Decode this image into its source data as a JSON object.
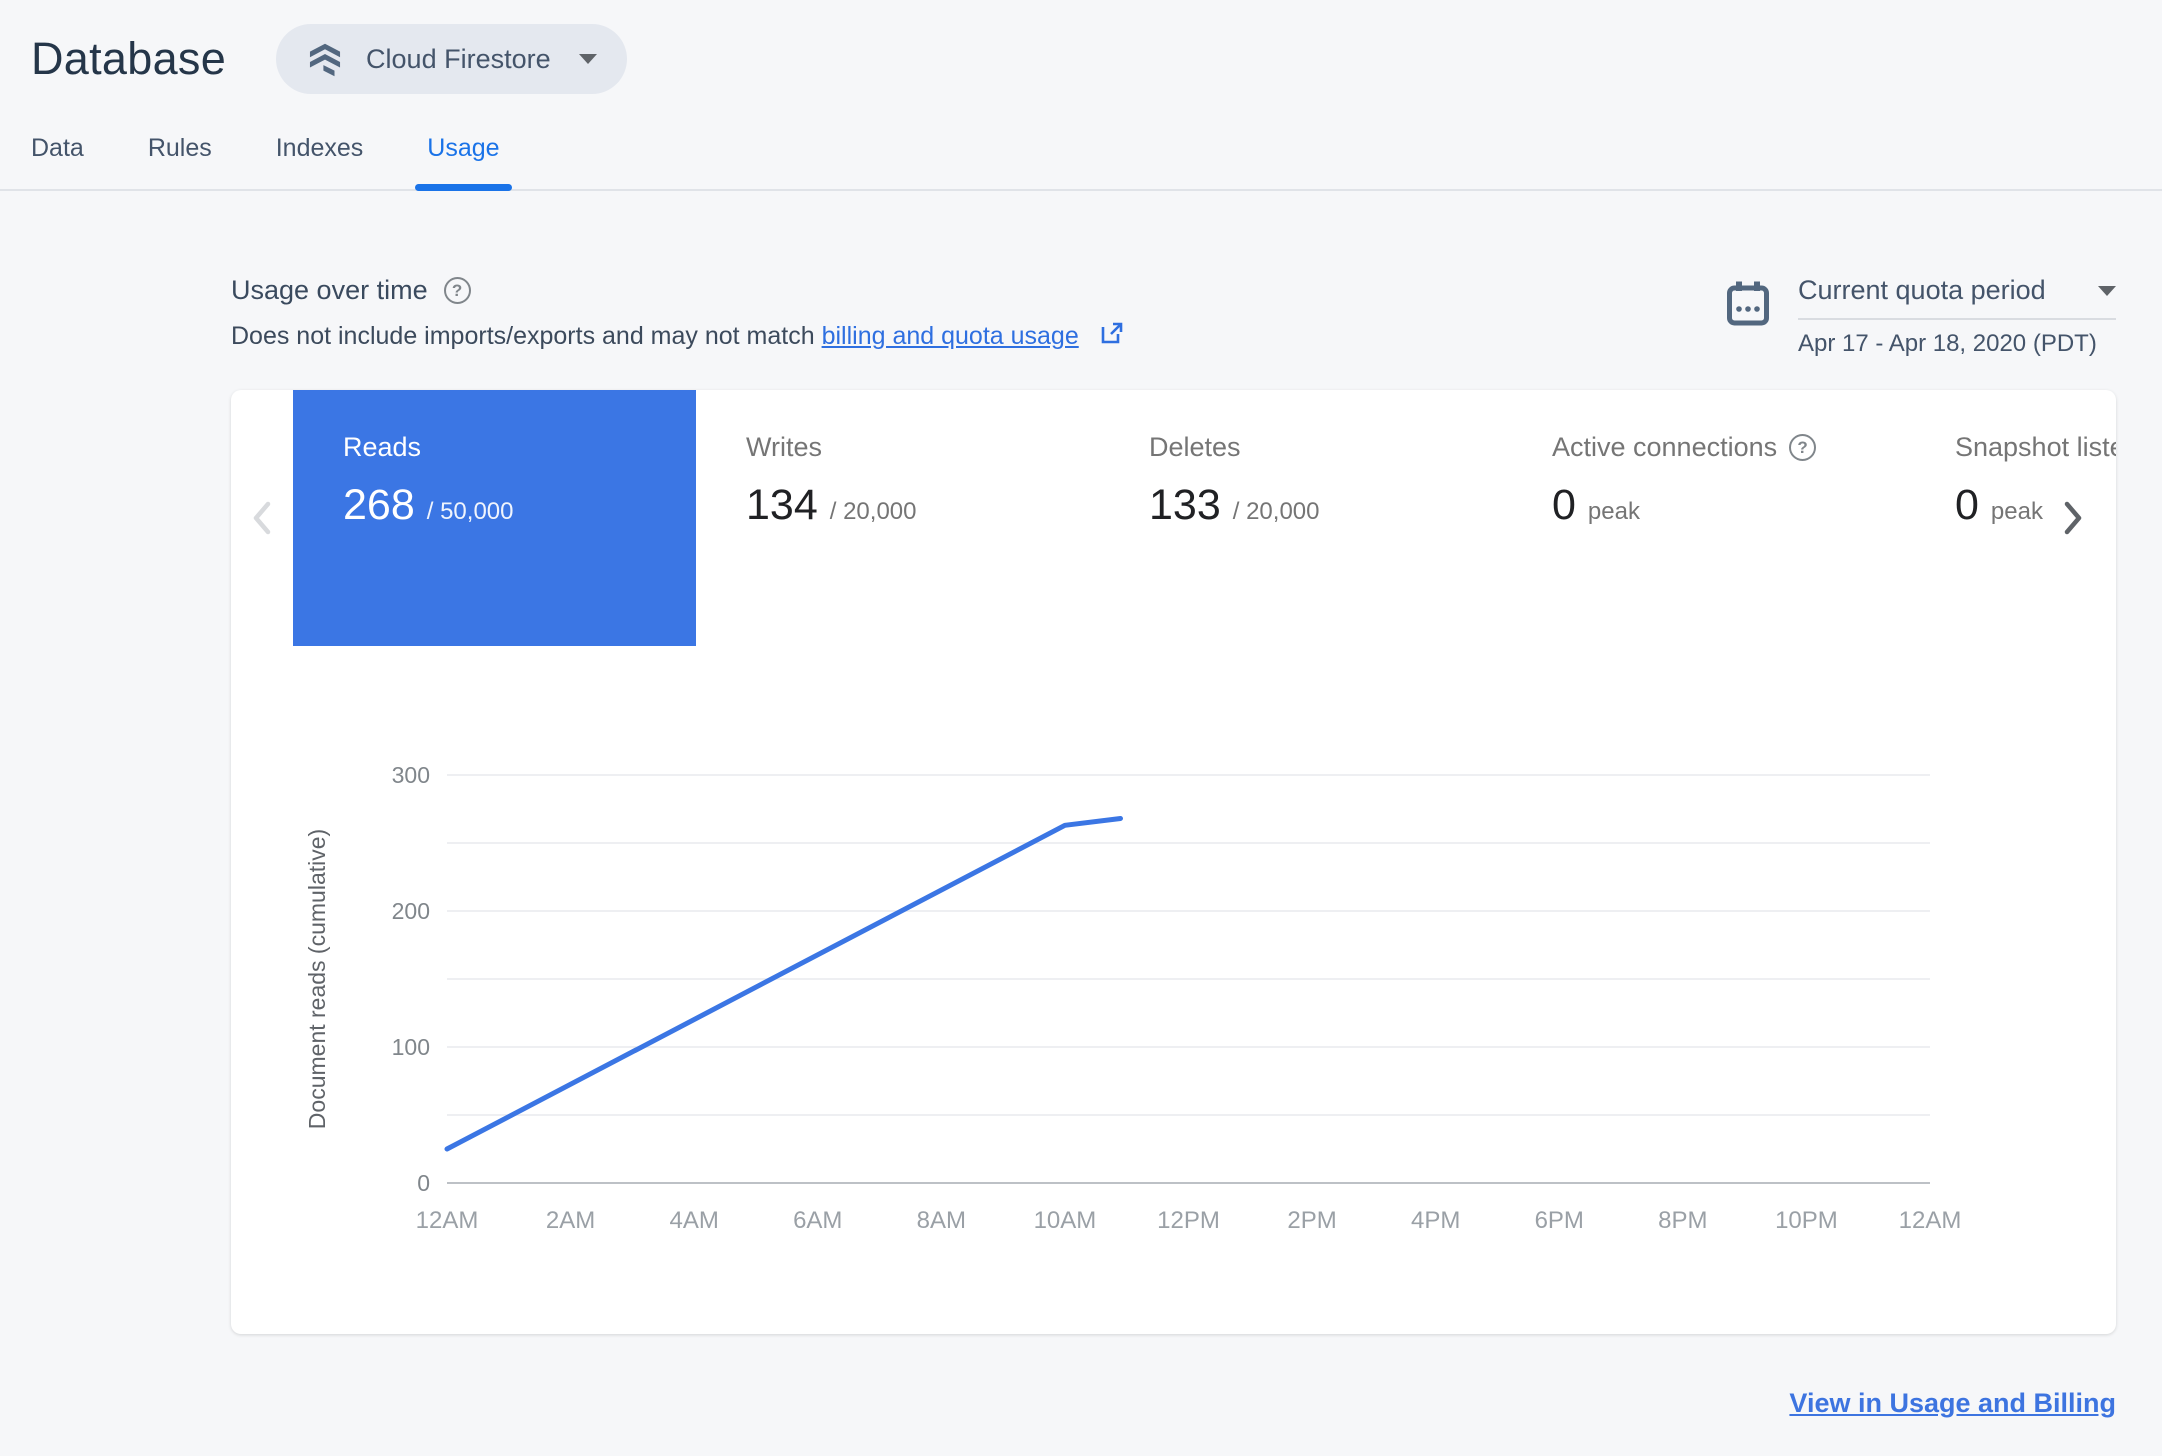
{
  "page": {
    "title": "Database"
  },
  "product_selector": {
    "label": "Cloud Firestore",
    "icon": "firestore-icon"
  },
  "tabs": [
    {
      "label": "Data",
      "active": false
    },
    {
      "label": "Rules",
      "active": false
    },
    {
      "label": "Indexes",
      "active": false
    },
    {
      "label": "Usage",
      "active": true
    }
  ],
  "section": {
    "title": "Usage over time",
    "subtitle_prefix": "Does not include imports/exports and may not match",
    "subtitle_link": "billing and quota usage",
    "quota_period": {
      "label": "Current quota period",
      "range": "Apr 17 - Apr 18, 2020 (PDT)"
    }
  },
  "usage_cards": {
    "items": [
      {
        "label": "Reads",
        "value": "268",
        "suffix": "/ 50,000",
        "selected": true
      },
      {
        "label": "Writes",
        "value": "134",
        "suffix": "/ 20,000",
        "selected": false
      },
      {
        "label": "Deletes",
        "value": "133",
        "suffix": "/ 20,000",
        "selected": false
      },
      {
        "label": "Active connections",
        "value": "0",
        "suffix": "peak",
        "selected": false,
        "help": true
      },
      {
        "label": "Snapshot listeners",
        "value": "0",
        "suffix": "peak",
        "selected": false
      }
    ]
  },
  "footer": {
    "link": "View in Usage and Billing"
  },
  "colors": {
    "accent_blue": "#1a73e8",
    "selected_card_blue": "#3b76e4",
    "chart_line_blue": "#3b76e4",
    "link_blue": "#2e6fe0",
    "title_navy": "#253649",
    "body_slate": "#3c4a5c",
    "muted_gray": "#757575",
    "grid_gray": "#e8eaed",
    "axis_gray": "#bdc1c6",
    "page_bg": "#f6f7f9",
    "panel_bg": "#ffffff",
    "pill_bg": "#e4e8ef",
    "icon_slate": "#52677f"
  },
  "chart_data": {
    "type": "line",
    "title": "",
    "xlabel": "",
    "ylabel": "Document reads (cumulative)",
    "ylim": [
      0,
      300
    ],
    "y_tick_labels": [
      0,
      100,
      200,
      300
    ],
    "grid_step": 50,
    "grid": true,
    "legend": "none",
    "x_range_hours": [
      0,
      24
    ],
    "x_tick_labels": [
      "12AM",
      "2AM",
      "4AM",
      "6AM",
      "8AM",
      "10AM",
      "12PM",
      "2PM",
      "4PM",
      "6PM",
      "8PM",
      "10PM",
      "12AM"
    ],
    "series": [
      {
        "name": "Document reads (cumulative)",
        "points": [
          {
            "hour": 0,
            "value": 25
          },
          {
            "hour": 10,
            "value": 263
          },
          {
            "hour": 10.9,
            "value": 268
          }
        ]
      }
    ],
    "line_color": "#3b76e4"
  }
}
